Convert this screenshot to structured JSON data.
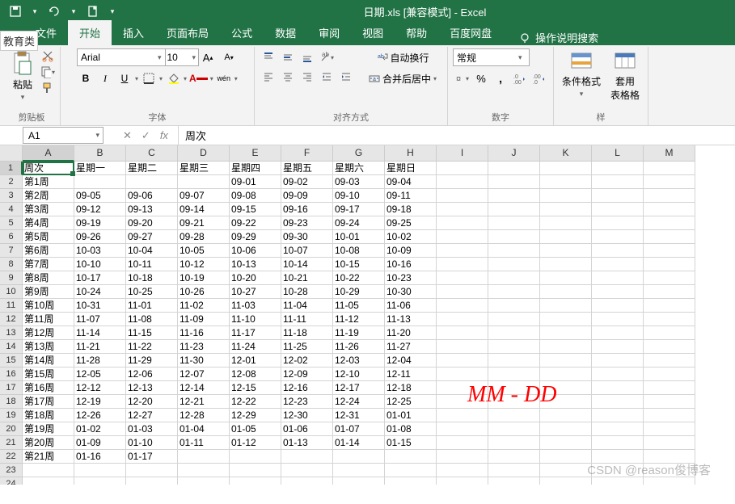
{
  "title": "日期.xls  [兼容模式]  -  Excel",
  "edu_label": "教育类",
  "qat": {
    "save": "保存",
    "undo": "撤销",
    "redo": "重做",
    "new": "新建"
  },
  "tabs": {
    "file": "文件",
    "home": "开始",
    "insert": "插入",
    "layout": "页面布局",
    "formulas": "公式",
    "data": "数据",
    "review": "审阅",
    "view": "视图",
    "help": "帮助",
    "baidu": "百度网盘"
  },
  "help_search": {
    "label": "操作说明搜索"
  },
  "ribbon": {
    "clipboard": {
      "paste": "粘贴",
      "label": "剪贴板"
    },
    "font": {
      "name": "Arial",
      "size": "10",
      "label": "字体",
      "bold": "B",
      "italic": "I",
      "underline": "U",
      "ruby": "wén"
    },
    "alignment": {
      "wrap": "自动换行",
      "merge": "合并后居中",
      "label": "对齐方式"
    },
    "number": {
      "format": "常规",
      "label": "数字"
    },
    "styles": {
      "cond_format": "条件格式",
      "cell_styles": "套用\n表格格",
      "label": "样"
    }
  },
  "namebox": {
    "cell": "A1",
    "fx": "fx",
    "formula": "周次"
  },
  "grid": {
    "cols": [
      "A",
      "B",
      "C",
      "D",
      "E",
      "F",
      "G",
      "H",
      "I",
      "J",
      "K",
      "L",
      "M"
    ],
    "headers": [
      "周次",
      "星期一",
      "星期二",
      "星期三",
      "星期四",
      "星期五",
      "星期六",
      "星期日"
    ],
    "rows": [
      [
        "第1周",
        "",
        "",
        "",
        "09-01",
        "09-02",
        "09-03",
        "09-04"
      ],
      [
        "第2周",
        "09-05",
        "09-06",
        "09-07",
        "09-08",
        "09-09",
        "09-10",
        "09-11"
      ],
      [
        "第3周",
        "09-12",
        "09-13",
        "09-14",
        "09-15",
        "09-16",
        "09-17",
        "09-18"
      ],
      [
        "第4周",
        "09-19",
        "09-20",
        "09-21",
        "09-22",
        "09-23",
        "09-24",
        "09-25"
      ],
      [
        "第5周",
        "09-26",
        "09-27",
        "09-28",
        "09-29",
        "09-30",
        "10-01",
        "10-02"
      ],
      [
        "第6周",
        "10-03",
        "10-04",
        "10-05",
        "10-06",
        "10-07",
        "10-08",
        "10-09"
      ],
      [
        "第7周",
        "10-10",
        "10-11",
        "10-12",
        "10-13",
        "10-14",
        "10-15",
        "10-16"
      ],
      [
        "第8周",
        "10-17",
        "10-18",
        "10-19",
        "10-20",
        "10-21",
        "10-22",
        "10-23"
      ],
      [
        "第9周",
        "10-24",
        "10-25",
        "10-26",
        "10-27",
        "10-28",
        "10-29",
        "10-30"
      ],
      [
        "第10周",
        "10-31",
        "11-01",
        "11-02",
        "11-03",
        "11-04",
        "11-05",
        "11-06"
      ],
      [
        "第11周",
        "11-07",
        "11-08",
        "11-09",
        "11-10",
        "11-11",
        "11-12",
        "11-13"
      ],
      [
        "第12周",
        "11-14",
        "11-15",
        "11-16",
        "11-17",
        "11-18",
        "11-19",
        "11-20"
      ],
      [
        "第13周",
        "11-21",
        "11-22",
        "11-23",
        "11-24",
        "11-25",
        "11-26",
        "11-27"
      ],
      [
        "第14周",
        "11-28",
        "11-29",
        "11-30",
        "12-01",
        "12-02",
        "12-03",
        "12-04"
      ],
      [
        "第15周",
        "12-05",
        "12-06",
        "12-07",
        "12-08",
        "12-09",
        "12-10",
        "12-11"
      ],
      [
        "第16周",
        "12-12",
        "12-13",
        "12-14",
        "12-15",
        "12-16",
        "12-17",
        "12-18"
      ],
      [
        "第17周",
        "12-19",
        "12-20",
        "12-21",
        "12-22",
        "12-23",
        "12-24",
        "12-25"
      ],
      [
        "第18周",
        "12-26",
        "12-27",
        "12-28",
        "12-29",
        "12-30",
        "12-31",
        "01-01"
      ],
      [
        "第19周",
        "01-02",
        "01-03",
        "01-04",
        "01-05",
        "01-06",
        "01-07",
        "01-08"
      ],
      [
        "第20周",
        "01-09",
        "01-10",
        "01-11",
        "01-12",
        "01-13",
        "01-14",
        "01-15"
      ],
      [
        "第21周",
        "01-16",
        "01-17",
        "",
        "",
        "",
        "",
        ""
      ]
    ]
  },
  "annotation": "MM - DD",
  "watermark": "CSDN @reason俊博客"
}
